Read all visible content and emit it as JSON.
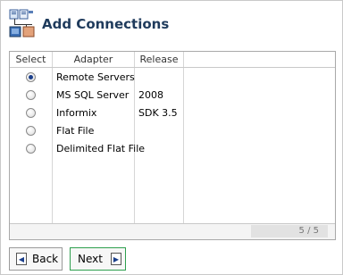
{
  "title": "Add Connections",
  "grid": {
    "columns": [
      "Select",
      "Adapter",
      "Release"
    ],
    "rows": [
      {
        "selected": true,
        "adapter": "Remote Servers",
        "release": ""
      },
      {
        "selected": false,
        "adapter": "MS SQL Server",
        "release": "2008"
      },
      {
        "selected": false,
        "adapter": "Informix",
        "release": "SDK 3.5"
      },
      {
        "selected": false,
        "adapter": "Flat File",
        "release": ""
      },
      {
        "selected": false,
        "adapter": "Delimited Flat File",
        "release": ""
      }
    ],
    "pager": "5 / 5"
  },
  "buttons": {
    "back_label": "Back",
    "next_label": "Next"
  },
  "icons": {
    "header": "connections-icon",
    "back": "arrow-left-icon",
    "next": "arrow-right-icon"
  },
  "colors": {
    "title": "#1f3b5c",
    "next_border": "#2e9f4e",
    "radio_dot": "#1b3f8b"
  }
}
